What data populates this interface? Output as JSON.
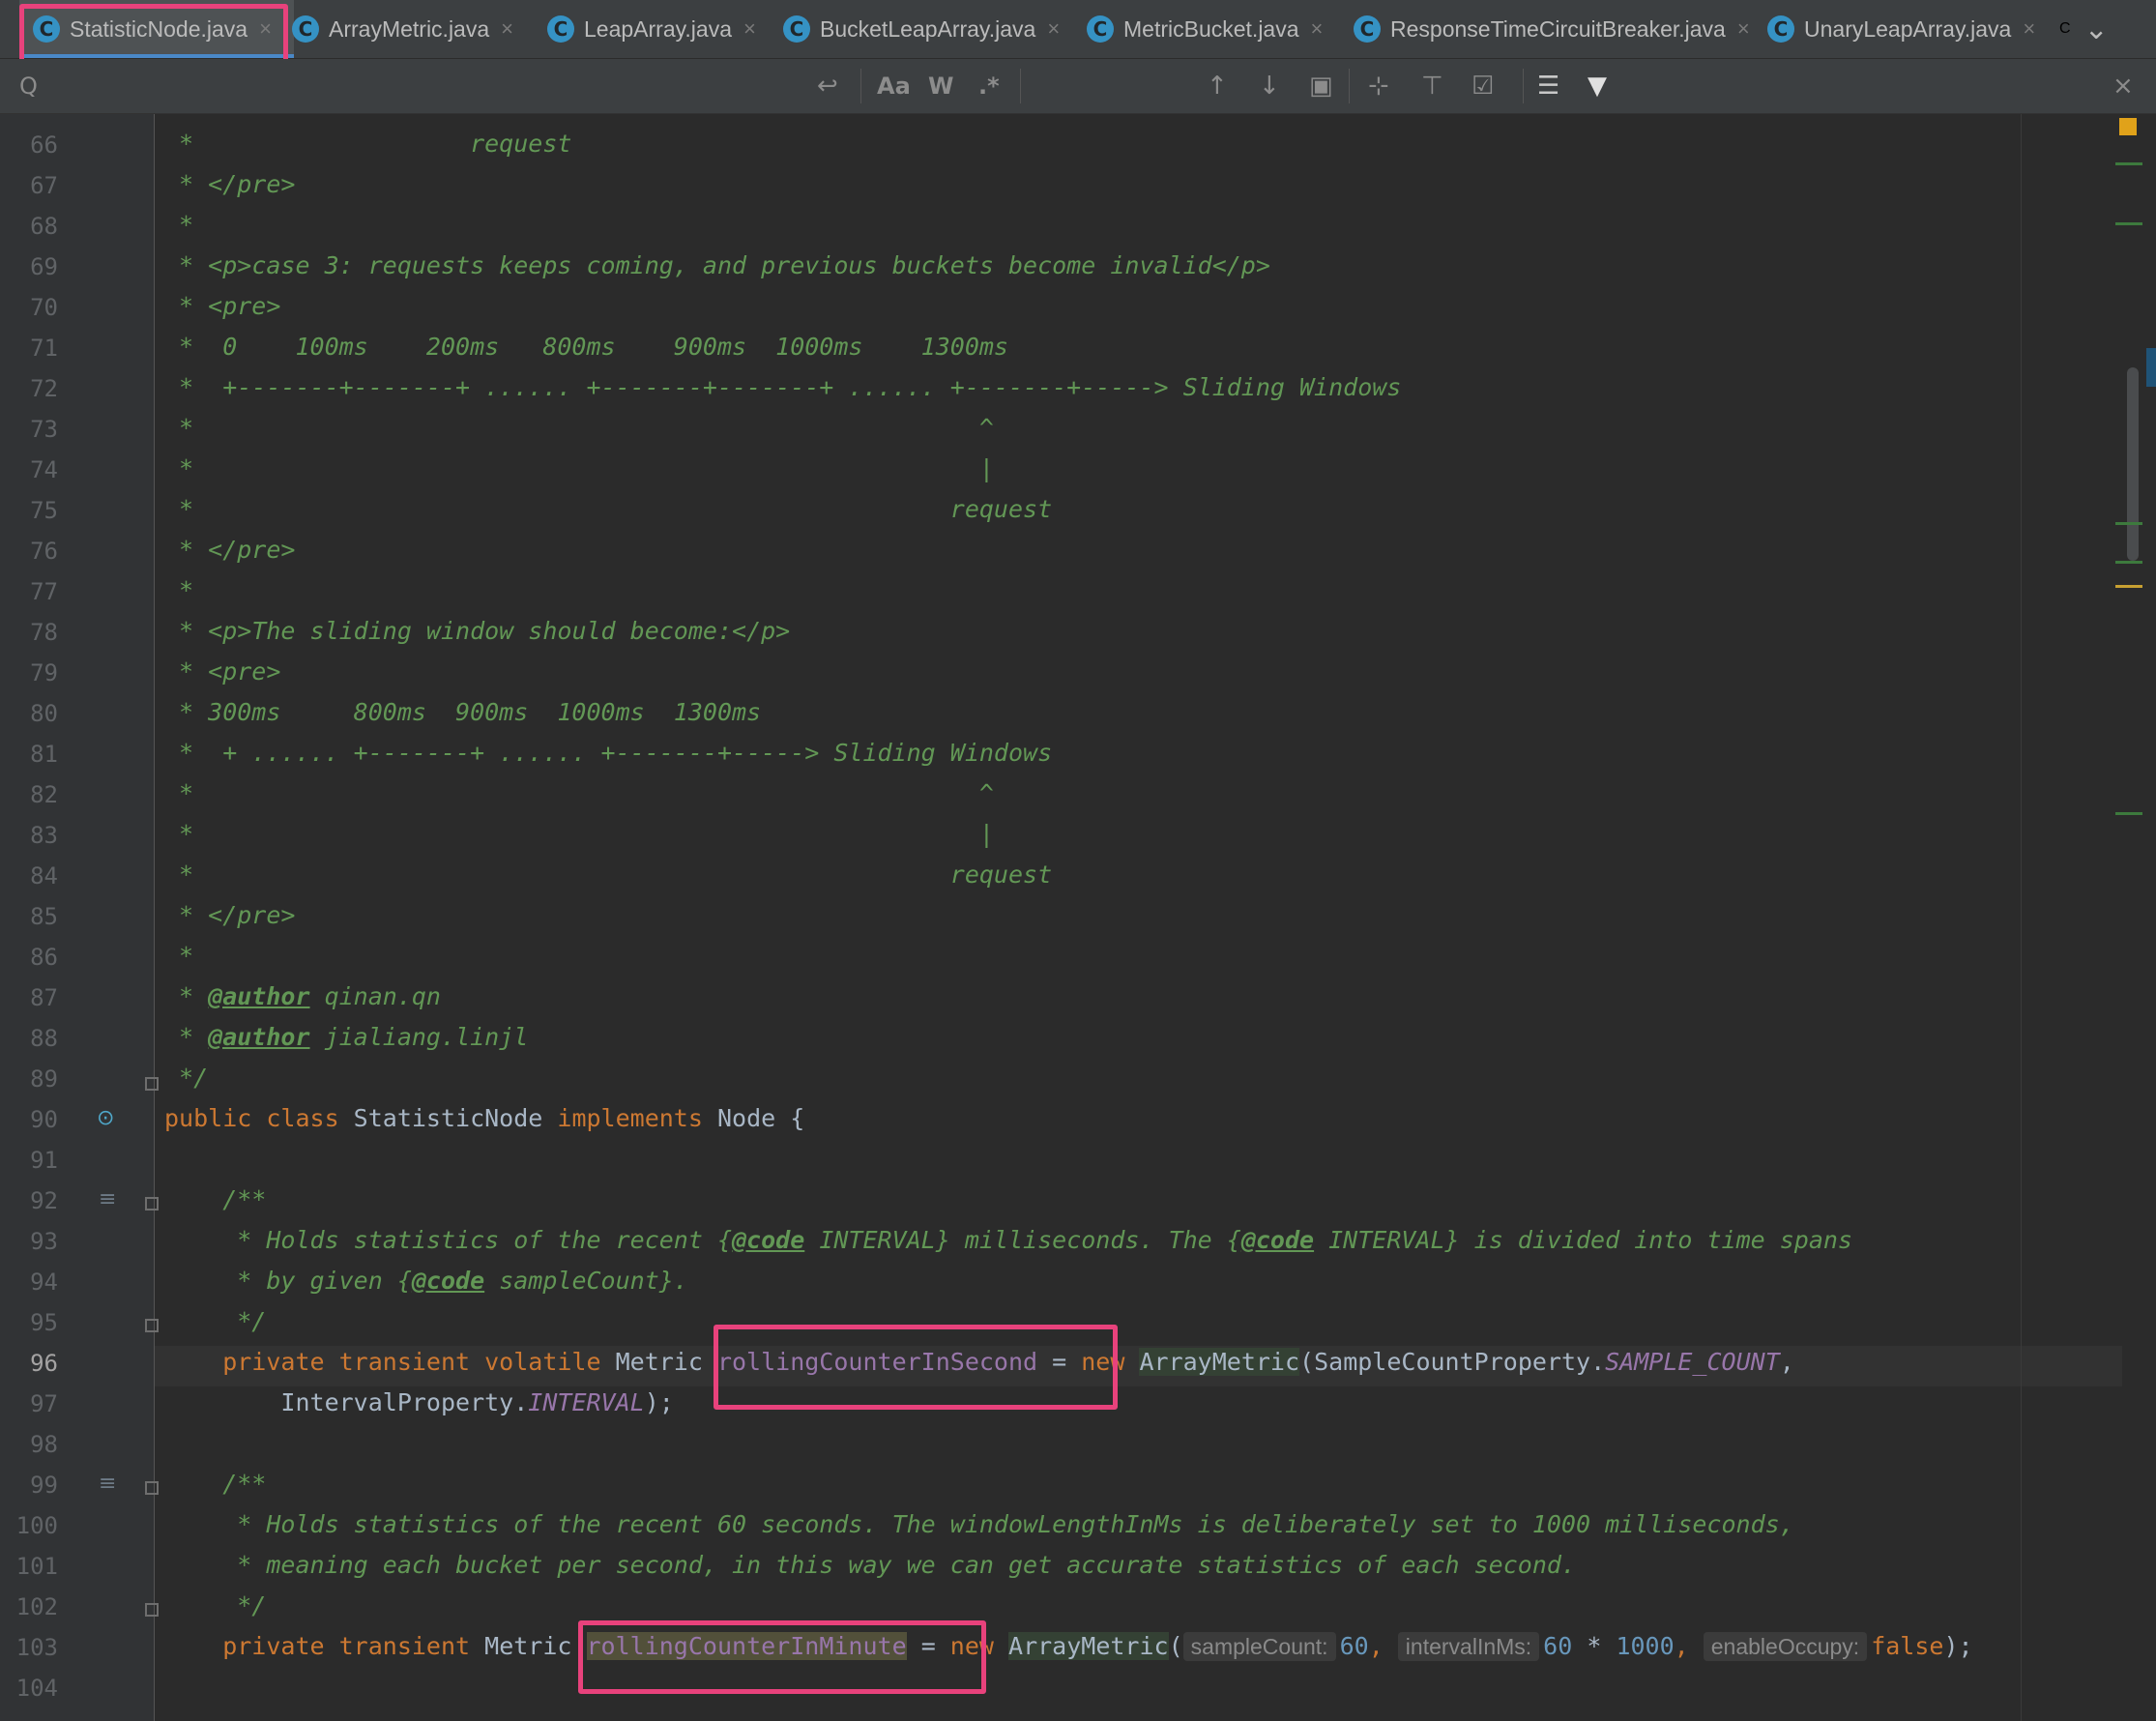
{
  "tabs": [
    {
      "label": "StatisticNode.java",
      "active": true
    },
    {
      "label": "ArrayMetric.java",
      "active": false
    },
    {
      "label": "LeapArray.java",
      "active": false
    },
    {
      "label": "BucketLeapArray.java",
      "active": false
    },
    {
      "label": "MetricBucket.java",
      "active": false
    },
    {
      "label": "ResponseTimeCircuitBreaker.java",
      "active": false
    },
    {
      "label": "UnaryLeapArray.java",
      "active": false
    }
  ],
  "tab_icon_letter": "C",
  "tab_close": "×",
  "tab_overflow": "⌄",
  "search": {
    "search_icon": "Q",
    "match_case": "Aa",
    "words": "W",
    "regex": ".*",
    "close": "×"
  },
  "current_line": "96",
  "lines": [
    {
      "n": "66"
    },
    {
      "n": "67"
    },
    {
      "n": "68"
    },
    {
      "n": "69"
    },
    {
      "n": "70"
    },
    {
      "n": "71"
    },
    {
      "n": "72"
    },
    {
      "n": "73"
    },
    {
      "n": "74"
    },
    {
      "n": "75"
    },
    {
      "n": "76"
    },
    {
      "n": "77"
    },
    {
      "n": "78"
    },
    {
      "n": "79"
    },
    {
      "n": "80"
    },
    {
      "n": "81"
    },
    {
      "n": "82"
    },
    {
      "n": "83"
    },
    {
      "n": "84"
    },
    {
      "n": "85"
    },
    {
      "n": "86"
    },
    {
      "n": "87"
    },
    {
      "n": "88"
    },
    {
      "n": "89"
    },
    {
      "n": "90"
    },
    {
      "n": "91"
    },
    {
      "n": "92"
    },
    {
      "n": "93"
    },
    {
      "n": "94"
    },
    {
      "n": "95"
    },
    {
      "n": "96"
    },
    {
      "n": "97"
    },
    {
      "n": "98"
    },
    {
      "n": "99"
    },
    {
      "n": "100"
    },
    {
      "n": "101"
    },
    {
      "n": "102"
    },
    {
      "n": "103"
    },
    {
      "n": "104"
    }
  ],
  "code": {
    "l66": " *                   request",
    "l67": " * ",
    "l67b": "</pre>",
    "l68": " *",
    "l69": " * ",
    "l69b": "<p>",
    "l69c": "case 3: requests keeps coming, and previous buckets become invalid",
    "l69d": "</p>",
    "l70": " * ",
    "l70b": "<pre>",
    "l71": " *  0    100ms    200ms   800ms    900ms  1000ms    1300ms",
    "l72": " *  +-------+-------+ ...... +-------+-------+ ...... +-------+-----> Sliding Windows",
    "l73": " *                                                      ^",
    "l74": " *                                                      |",
    "l75": " *                                                    request",
    "l76": " * ",
    "l76b": "</pre>",
    "l77": " *",
    "l78": " * ",
    "l78b": "<p>",
    "l78c": "The sliding window should become:",
    "l78d": "</p>",
    "l79": " * ",
    "l79b": "<pre>",
    "l80": " * 300ms     800ms  900ms  1000ms  1300ms",
    "l81": " *  + ...... +-------+ ...... +-------+-----> Sliding Windows",
    "l82": " *                                                      ^",
    "l83": " *                                                      |",
    "l84": " *                                                    request",
    "l85": " * ",
    "l85b": "</pre>",
    "l86": " *",
    "l87": " * ",
    "l87b": "@author",
    "l87c": " qinan.qn",
    "l88": " * ",
    "l88b": "@author",
    "l88c": " jialiang.linjl",
    "l89": " */",
    "l90a": "public class ",
    "l90b": "StatisticNode ",
    "l90c": "implements ",
    "l90d": "Node {",
    "l92": "    /**",
    "l93a": "     * Holds statistics of the recent {",
    "l93b": "@code",
    "l93c": " INTERVAL} milliseconds. The {",
    "l93d": "@code",
    "l93e": " INTERVAL} is divided into time spans",
    "l94a": "     * by given {",
    "l94b": "@code",
    "l94c": " sampleCount}.",
    "l95": "     */",
    "l96a": "    private transient volatile ",
    "l96b": "Metric ",
    "l96c": "rollingCounterInSecond",
    "l96d": " = ",
    "l96e": "new ",
    "l96f": "ArrayMetric",
    "l96g": "(SampleCountProperty.",
    "l96h": "SAMPLE_COUNT",
    "l96i": ",",
    "l97a": "        IntervalProperty.",
    "l97b": "INTERVAL",
    "l97c": ");",
    "l99": "    /**",
    "l100": "     * Holds statistics of the recent 60 seconds. The windowLengthInMs is deliberately set to 1000 milliseconds,",
    "l101": "     * meaning each bucket per second, in this way we can get accurate statistics of each second.",
    "l102": "     */",
    "l103a": "    private transient ",
    "l103b": "Metric ",
    "l103c": "rollingCounterInMinute",
    "l103d": " = ",
    "l103e": "new ",
    "l103f": "ArrayMetric",
    "l103g": "(",
    "l103h1": "sampleCount:",
    "l103v1": "60",
    "l103s1": ", ",
    "l103h2": "intervalInMs:",
    "l103v2": "60",
    "l103op": " * ",
    "l103v3": "1000",
    "l103s2": ", ",
    "l103h3": "enableOccupy:",
    "l103v4": "false",
    "l103end": ");"
  }
}
